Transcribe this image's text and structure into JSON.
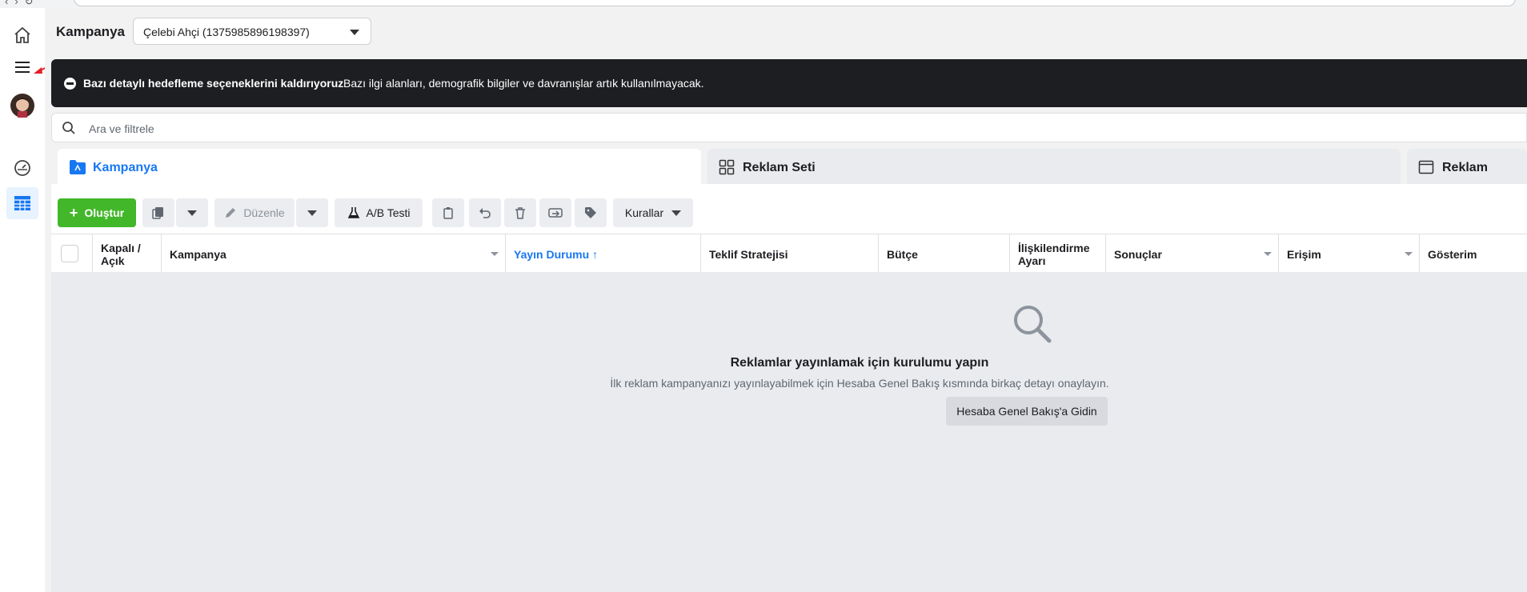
{
  "app": {
    "title": "Kampanya"
  },
  "account_selector": {
    "value": "Çelebi Ahçi (1375985896198397)"
  },
  "banner": {
    "title": "Bazı detaylı hedefleme seçeneklerini kaldırıyoruz",
    "message": "Bazı ilgi alanları, demografik bilgiler ve davranışlar artık kullanılmayacak."
  },
  "search": {
    "placeholder": "Ara ve filtrele",
    "value": ""
  },
  "tabs": [
    {
      "label": "Kampanya",
      "icon": "folder-icon",
      "selected": true
    },
    {
      "label": "Reklam Seti",
      "icon": "grid-icon",
      "selected": false
    },
    {
      "label": "Reklam",
      "icon": "window-icon",
      "selected": false
    }
  ],
  "toolbar": {
    "create_label": "Oluştur",
    "edit_label": "Düzenle",
    "ab_test_label": "A/B Testi",
    "rules_label": "Kurallar"
  },
  "table": {
    "columns": [
      "Kapalı / Açık",
      "Kampanya",
      "Yayın Durumu ↑",
      "Teklif Stratejisi",
      "Bütçe",
      "İlişkilendirme Ayarı",
      "Sonuçlar",
      "Erişim",
      "Gösterim"
    ]
  },
  "empty_state": {
    "title": "Reklamlar yayınlamak için kurulumu yapın",
    "subtitle": "İlk reklam kampanyanızı yayınlayabilmek için Hesaba Genel Bakış kısmında birkaç detayı onaylayın.",
    "button_label": "Hesaba Genel Bakış'a Gidin"
  },
  "colors": {
    "accent": "#1877f2",
    "create_green": "#42b72a",
    "banner_bg": "#1c1e21",
    "annotation_arrow": "#e41e26"
  }
}
